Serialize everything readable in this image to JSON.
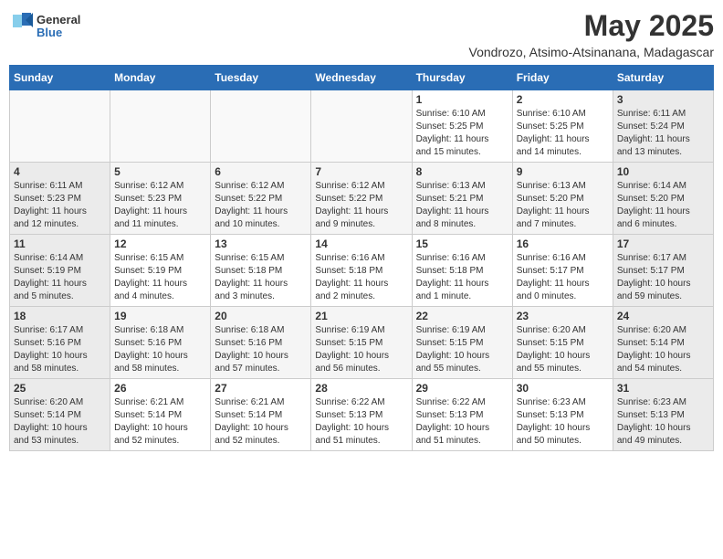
{
  "logo": {
    "general": "General",
    "blue": "Blue"
  },
  "title": {
    "month_year": "May 2025",
    "location": "Vondrozo, Atsimo-Atsinanana, Madagascar"
  },
  "headers": [
    "Sunday",
    "Monday",
    "Tuesday",
    "Wednesday",
    "Thursday",
    "Friday",
    "Saturday"
  ],
  "weeks": [
    [
      {
        "day": "",
        "info": ""
      },
      {
        "day": "",
        "info": ""
      },
      {
        "day": "",
        "info": ""
      },
      {
        "day": "",
        "info": ""
      },
      {
        "day": "1",
        "info": "Sunrise: 6:10 AM\nSunset: 5:25 PM\nDaylight: 11 hours\nand 15 minutes."
      },
      {
        "day": "2",
        "info": "Sunrise: 6:10 AM\nSunset: 5:25 PM\nDaylight: 11 hours\nand 14 minutes."
      },
      {
        "day": "3",
        "info": "Sunrise: 6:11 AM\nSunset: 5:24 PM\nDaylight: 11 hours\nand 13 minutes."
      }
    ],
    [
      {
        "day": "4",
        "info": "Sunrise: 6:11 AM\nSunset: 5:23 PM\nDaylight: 11 hours\nand 12 minutes."
      },
      {
        "day": "5",
        "info": "Sunrise: 6:12 AM\nSunset: 5:23 PM\nDaylight: 11 hours\nand 11 minutes."
      },
      {
        "day": "6",
        "info": "Sunrise: 6:12 AM\nSunset: 5:22 PM\nDaylight: 11 hours\nand 10 minutes."
      },
      {
        "day": "7",
        "info": "Sunrise: 6:12 AM\nSunset: 5:22 PM\nDaylight: 11 hours\nand 9 minutes."
      },
      {
        "day": "8",
        "info": "Sunrise: 6:13 AM\nSunset: 5:21 PM\nDaylight: 11 hours\nand 8 minutes."
      },
      {
        "day": "9",
        "info": "Sunrise: 6:13 AM\nSunset: 5:20 PM\nDaylight: 11 hours\nand 7 minutes."
      },
      {
        "day": "10",
        "info": "Sunrise: 6:14 AM\nSunset: 5:20 PM\nDaylight: 11 hours\nand 6 minutes."
      }
    ],
    [
      {
        "day": "11",
        "info": "Sunrise: 6:14 AM\nSunset: 5:19 PM\nDaylight: 11 hours\nand 5 minutes."
      },
      {
        "day": "12",
        "info": "Sunrise: 6:15 AM\nSunset: 5:19 PM\nDaylight: 11 hours\nand 4 minutes."
      },
      {
        "day": "13",
        "info": "Sunrise: 6:15 AM\nSunset: 5:18 PM\nDaylight: 11 hours\nand 3 minutes."
      },
      {
        "day": "14",
        "info": "Sunrise: 6:16 AM\nSunset: 5:18 PM\nDaylight: 11 hours\nand 2 minutes."
      },
      {
        "day": "15",
        "info": "Sunrise: 6:16 AM\nSunset: 5:18 PM\nDaylight: 11 hours\nand 1 minute."
      },
      {
        "day": "16",
        "info": "Sunrise: 6:16 AM\nSunset: 5:17 PM\nDaylight: 11 hours\nand 0 minutes."
      },
      {
        "day": "17",
        "info": "Sunrise: 6:17 AM\nSunset: 5:17 PM\nDaylight: 10 hours\nand 59 minutes."
      }
    ],
    [
      {
        "day": "18",
        "info": "Sunrise: 6:17 AM\nSunset: 5:16 PM\nDaylight: 10 hours\nand 58 minutes."
      },
      {
        "day": "19",
        "info": "Sunrise: 6:18 AM\nSunset: 5:16 PM\nDaylight: 10 hours\nand 58 minutes."
      },
      {
        "day": "20",
        "info": "Sunrise: 6:18 AM\nSunset: 5:16 PM\nDaylight: 10 hours\nand 57 minutes."
      },
      {
        "day": "21",
        "info": "Sunrise: 6:19 AM\nSunset: 5:15 PM\nDaylight: 10 hours\nand 56 minutes."
      },
      {
        "day": "22",
        "info": "Sunrise: 6:19 AM\nSunset: 5:15 PM\nDaylight: 10 hours\nand 55 minutes."
      },
      {
        "day": "23",
        "info": "Sunrise: 6:20 AM\nSunset: 5:15 PM\nDaylight: 10 hours\nand 55 minutes."
      },
      {
        "day": "24",
        "info": "Sunrise: 6:20 AM\nSunset: 5:14 PM\nDaylight: 10 hours\nand 54 minutes."
      }
    ],
    [
      {
        "day": "25",
        "info": "Sunrise: 6:20 AM\nSunset: 5:14 PM\nDaylight: 10 hours\nand 53 minutes."
      },
      {
        "day": "26",
        "info": "Sunrise: 6:21 AM\nSunset: 5:14 PM\nDaylight: 10 hours\nand 52 minutes."
      },
      {
        "day": "27",
        "info": "Sunrise: 6:21 AM\nSunset: 5:14 PM\nDaylight: 10 hours\nand 52 minutes."
      },
      {
        "day": "28",
        "info": "Sunrise: 6:22 AM\nSunset: 5:13 PM\nDaylight: 10 hours\nand 51 minutes."
      },
      {
        "day": "29",
        "info": "Sunrise: 6:22 AM\nSunset: 5:13 PM\nDaylight: 10 hours\nand 51 minutes."
      },
      {
        "day": "30",
        "info": "Sunrise: 6:23 AM\nSunset: 5:13 PM\nDaylight: 10 hours\nand 50 minutes."
      },
      {
        "day": "31",
        "info": "Sunrise: 6:23 AM\nSunset: 5:13 PM\nDaylight: 10 hours\nand 49 minutes."
      }
    ]
  ]
}
